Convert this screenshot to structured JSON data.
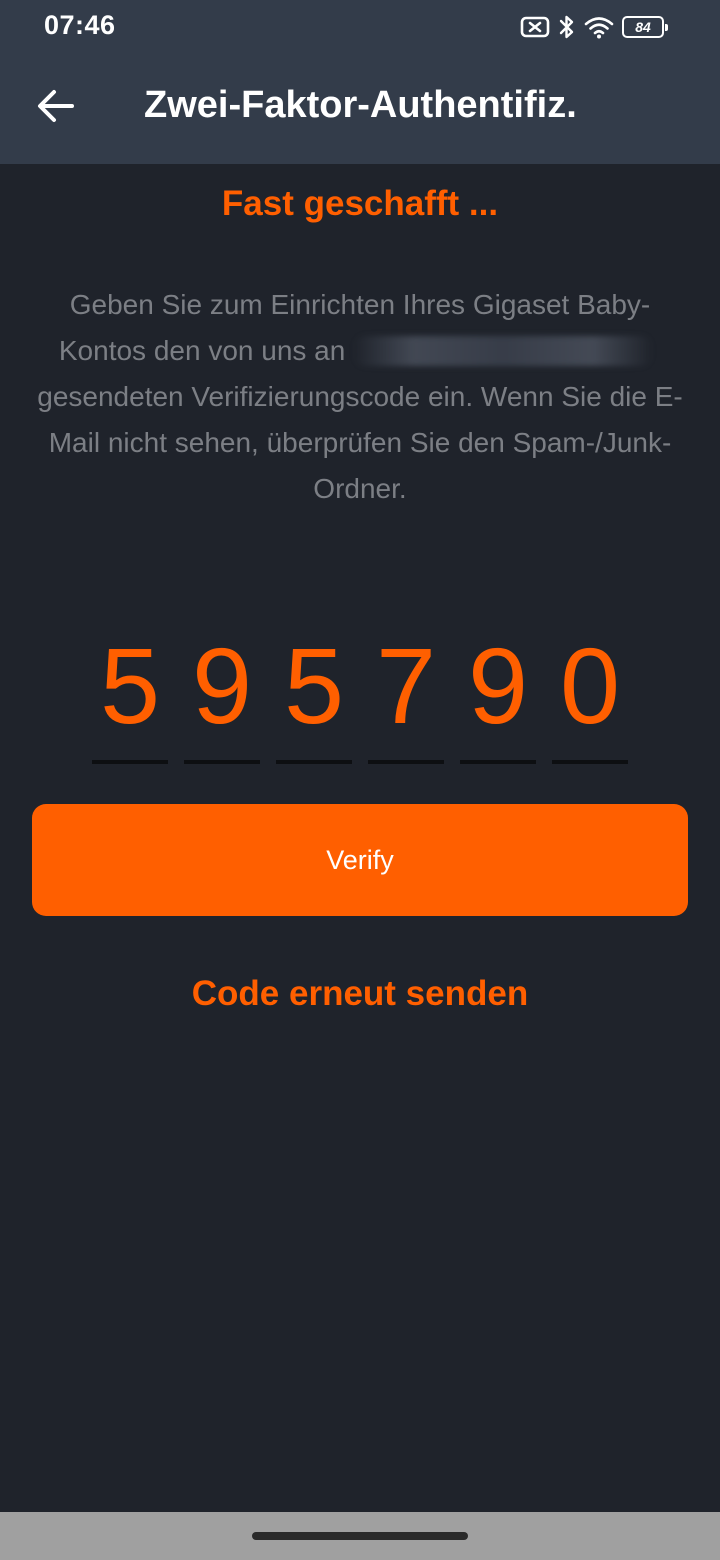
{
  "status_bar": {
    "time": "07:46",
    "icons": [
      "no-sim-icon",
      "bluetooth-icon",
      "wifi-icon",
      "battery-icon"
    ],
    "battery_level": "84"
  },
  "app_bar": {
    "back_icon": "arrow-left-icon",
    "title": "Zwei-Faktor-Authentifiz."
  },
  "content": {
    "subtitle": "Fast geschafft ...",
    "instructions_before": "Geben Sie zum Einrichten Ihres Gigaset Baby-Kontos den von uns an",
    "instructions_after": "gesendeten Verifizierungscode ein. Wenn Sie die E-Mail nicht sehen, überprüfen Sie den Spam-/Junk-Ordner.",
    "code_digits": [
      "5",
      "9",
      "5",
      "7",
      "9",
      "0"
    ],
    "verify_label": "Verify",
    "resend_label": "Code erneut senden"
  },
  "colors": {
    "accent": "#ff5f00",
    "header_bg": "#333c4a",
    "screen_bg": "#1f232b",
    "muted_text": "#7c7f85",
    "nav_bar_bg": "#a0a0a0"
  }
}
